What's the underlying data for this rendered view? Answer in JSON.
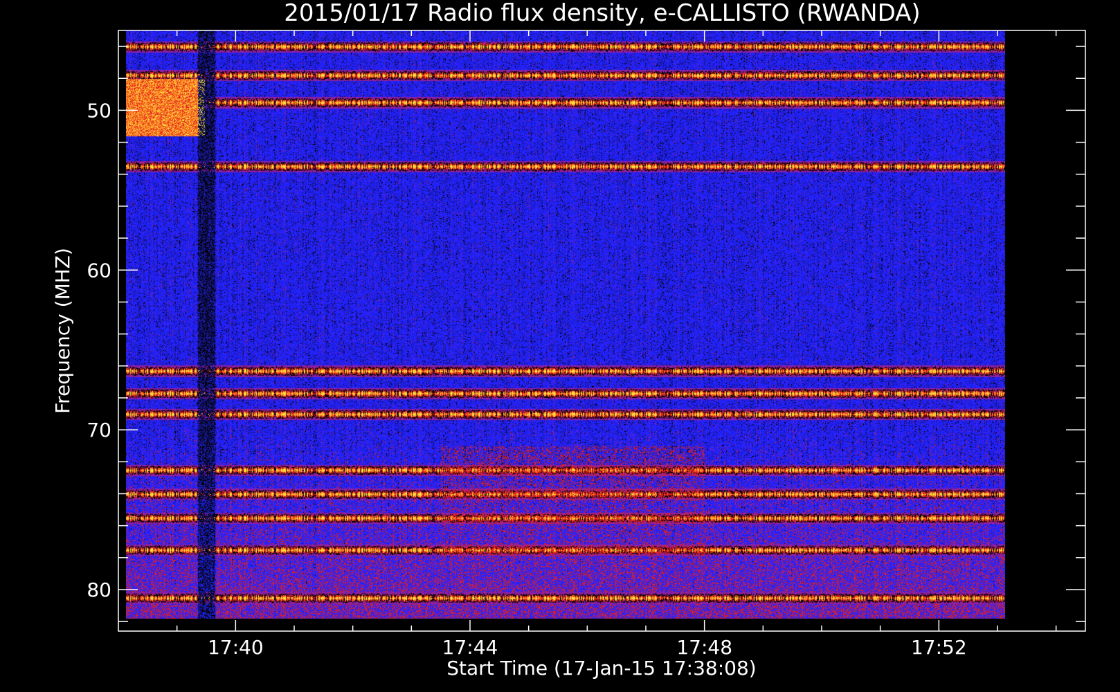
{
  "chart_data": {
    "type": "heatmap",
    "title": "2015/01/17  Radio flux density, e-CALLISTO (RWANDA)",
    "xlabel": "Start Time (17-Jan-15 17:38:08)",
    "ylabel": "Frequency (MHZ)",
    "x_axis": {
      "unit": "minutes after 17:38",
      "range": [
        0,
        16.5
      ],
      "data_range": [
        0.13,
        15.13
      ],
      "ticks": [
        {
          "value": 2,
          "label": "17:40"
        },
        {
          "value": 6,
          "label": "17:44"
        },
        {
          "value": 10,
          "label": "17:48"
        },
        {
          "value": 14,
          "label": "17:52"
        }
      ]
    },
    "y_axis": {
      "unit": "MHz",
      "range": [
        45,
        82.6
      ],
      "data_range": [
        45,
        81.8
      ],
      "inverted": true,
      "ticks": [
        {
          "value": 50,
          "label": "50"
        },
        {
          "value": 60,
          "label": "60"
        },
        {
          "value": 70,
          "label": "70"
        },
        {
          "value": 80,
          "label": "80"
        }
      ]
    },
    "colormap": [
      "#000000",
      "#1a1aa0",
      "#2222ff",
      "#9020a0",
      "#e02020",
      "#ff8020",
      "#ffe040"
    ],
    "background_level": "#2222ff",
    "bright_bands_mhz": [
      46.0,
      47.8,
      49.5,
      53.5,
      66.3,
      67.7,
      69.0,
      72.5,
      74.0,
      75.5,
      77.5,
      80.5
    ],
    "burst": {
      "t_start": 0.13,
      "t_end": 1.47,
      "f_low": 48.0,
      "f_high": 51.6
    },
    "data_gap": {
      "t": 1.5,
      "width": 0.3
    },
    "enhanced_region": {
      "t_start": 5.5,
      "t_end": 10.0,
      "f_low": 71.0,
      "f_high": 80.0
    }
  }
}
